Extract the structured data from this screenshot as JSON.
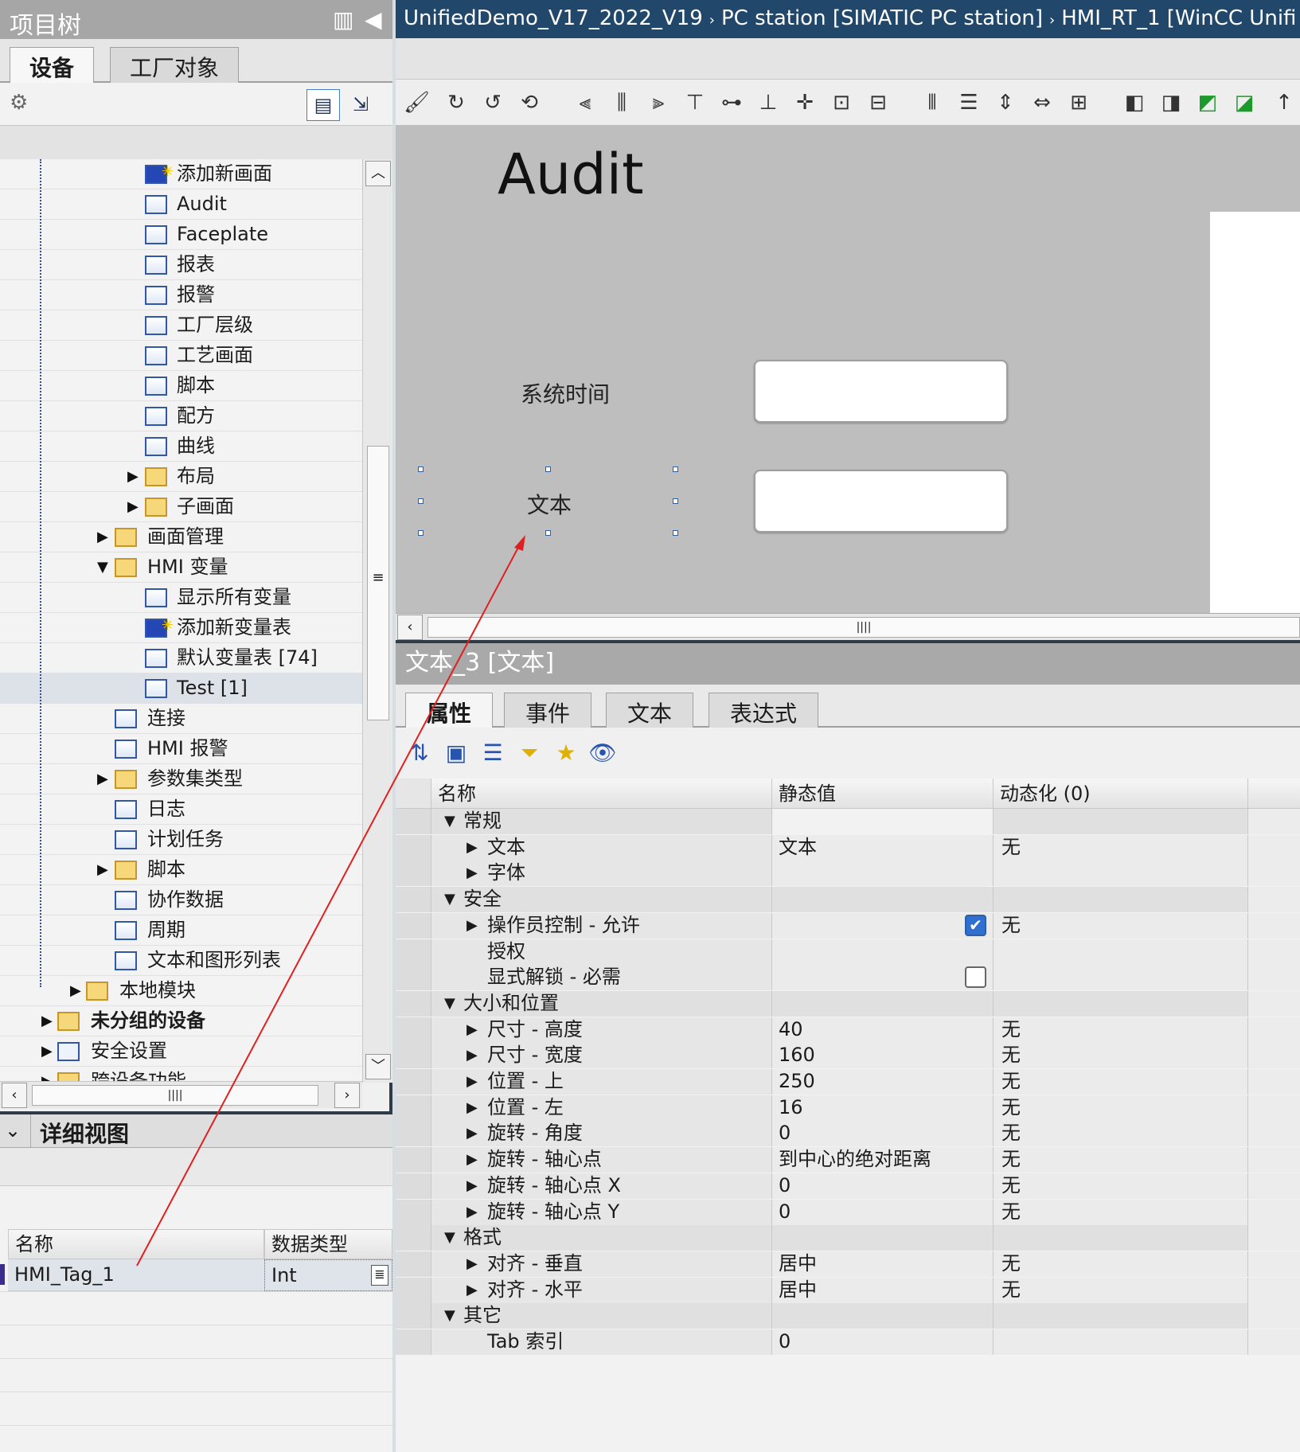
{
  "project_tree": {
    "title": "项目树",
    "tabs": [
      "设备",
      "工厂对象"
    ],
    "items": [
      {
        "label": "添加新画面",
        "icon": "add-screen-icon",
        "indent": 0
      },
      {
        "label": "Audit",
        "icon": "screen-icon",
        "indent": 0
      },
      {
        "label": "Faceplate",
        "icon": "screen-icon",
        "indent": 0
      },
      {
        "label": "报表",
        "icon": "screen-icon",
        "indent": 0
      },
      {
        "label": "报警",
        "icon": "screen-icon",
        "indent": 0
      },
      {
        "label": "工厂层级",
        "icon": "screen-icon",
        "indent": 0
      },
      {
        "label": "工艺画面",
        "icon": "screen-icon",
        "indent": 0
      },
      {
        "label": "脚本",
        "icon": "screen-icon",
        "indent": 0
      },
      {
        "label": "配方",
        "icon": "screen-icon",
        "indent": 0
      },
      {
        "label": "曲线",
        "icon": "screen-icon",
        "indent": 0
      },
      {
        "label": "布局",
        "icon": "folder-icon",
        "indent": 0,
        "expander": "collapsed"
      },
      {
        "label": "子画面",
        "icon": "folder-icon",
        "indent": 0,
        "expander": "collapsed"
      },
      {
        "label": "画面管理",
        "icon": "screen-management-icon",
        "indent": 1,
        "expander": "collapsed"
      },
      {
        "label": "HMI 变量",
        "icon": "hmi-tags-folder-icon",
        "indent": 1,
        "expander": "expanded"
      },
      {
        "label": "显示所有变量",
        "icon": "tag-table-icon",
        "indent": 0
      },
      {
        "label": "添加新变量表",
        "icon": "add-tag-table-icon",
        "indent": 0
      },
      {
        "label": "默认变量表 [74]",
        "icon": "tag-table-icon",
        "indent": 0
      },
      {
        "label": "Test [1]",
        "icon": "tag-table-icon",
        "indent": 0,
        "selected": true
      },
      {
        "label": "连接",
        "icon": "connection-icon",
        "indent": 1
      },
      {
        "label": "HMI 报警",
        "icon": "alarm-icon",
        "indent": 1
      },
      {
        "label": "参数集类型",
        "icon": "folder-icon",
        "indent": 1,
        "expander": "collapsed"
      },
      {
        "label": "日志",
        "icon": "log-icon",
        "indent": 1
      },
      {
        "label": "计划任务",
        "icon": "scheduler-icon",
        "indent": 1
      },
      {
        "label": "脚本",
        "icon": "script-folder-icon",
        "indent": 1,
        "expander": "collapsed"
      },
      {
        "label": "协作数据",
        "icon": "collaboration-icon",
        "indent": 1
      },
      {
        "label": "周期",
        "icon": "cycle-icon",
        "indent": 1
      },
      {
        "label": "文本和图形列表",
        "icon": "text-graphic-list-icon",
        "indent": 1
      },
      {
        "label": "本地模块",
        "icon": "local-modules-icon",
        "indent": 2,
        "expander": "collapsed"
      },
      {
        "label": "未分组的设备",
        "icon": "ungrouped-devices-icon",
        "indent": 3,
        "expander": "collapsed",
        "bold": true
      },
      {
        "label": "安全设置",
        "icon": "security-icon",
        "indent": 3,
        "expander": "collapsed"
      },
      {
        "label": "跨设备功能",
        "icon": "cross-device-icon",
        "indent": 3,
        "expander": "collapsed"
      }
    ]
  },
  "detail_view": {
    "title": "详细视图",
    "columns": [
      "名称",
      "数据类型"
    ],
    "rows": [
      {
        "name": "HMI_Tag_1",
        "type": "Int"
      }
    ]
  },
  "breadcrumb": [
    "UnifiedDemo_V17_2022_V19",
    "PC station [SIMATIC PC station]",
    "HMI_RT_1 [WinCC Unifi"
  ],
  "screen": {
    "title": "Audit",
    "label_time": "系统时间",
    "label_text": "文本"
  },
  "inspector": {
    "title": "文本_3 [文本]",
    "tabs": [
      "属性",
      "事件",
      "文本",
      "表达式"
    ],
    "columns": [
      "名称",
      "静态值",
      "动态化 (0)"
    ],
    "rows": [
      {
        "name": "常规",
        "level": 0,
        "static": "",
        "dyn": ""
      },
      {
        "name": "文本",
        "level": 1,
        "static": "文本",
        "dyn": "无"
      },
      {
        "name": "字体",
        "level": 1,
        "static": "",
        "dyn": ""
      },
      {
        "name": "安全",
        "level": 0,
        "static": "",
        "dyn": ""
      },
      {
        "name": "操作员控制 - 允许",
        "level": 1,
        "static": "",
        "dyn": "无",
        "checkbox": "checked"
      },
      {
        "name": "授权",
        "level": 2,
        "static": "",
        "dyn": ""
      },
      {
        "name": "显式解锁 - 必需",
        "level": 2,
        "static": "",
        "dyn": "",
        "checkbox": "unchecked"
      },
      {
        "name": "大小和位置",
        "level": 0,
        "static": "",
        "dyn": ""
      },
      {
        "name": "尺寸 - 高度",
        "level": 1,
        "static": "40",
        "dyn": "无"
      },
      {
        "name": "尺寸 - 宽度",
        "level": 1,
        "static": "160",
        "dyn": "无"
      },
      {
        "name": "位置 - 上",
        "level": 1,
        "static": "250",
        "dyn": "无"
      },
      {
        "name": "位置 - 左",
        "level": 1,
        "static": "16",
        "dyn": "无"
      },
      {
        "name": "旋转 - 角度",
        "level": 1,
        "static": "0",
        "dyn": "无"
      },
      {
        "name": "旋转 - 轴心点",
        "level": 1,
        "static": "到中心的绝对距离",
        "dyn": "无"
      },
      {
        "name": "旋转 - 轴心点 X",
        "level": 1,
        "static": "0",
        "dyn": "无"
      },
      {
        "name": "旋转 - 轴心点 Y",
        "level": 1,
        "static": "0",
        "dyn": "无"
      },
      {
        "name": "格式",
        "level": 0,
        "static": "",
        "dyn": ""
      },
      {
        "name": "对齐 - 垂直",
        "level": 1,
        "static": "居中",
        "dyn": "无"
      },
      {
        "name": "对齐 - 水平",
        "level": 1,
        "static": "居中",
        "dyn": "无"
      },
      {
        "name": "其它",
        "level": 0,
        "static": "",
        "dyn": ""
      },
      {
        "name": "Tab 索引",
        "level": 2,
        "static": "0",
        "dyn": ""
      }
    ]
  },
  "colors": {
    "accent": "#21476b",
    "selection": "#2a5fb0",
    "arrow": "#e02020"
  }
}
